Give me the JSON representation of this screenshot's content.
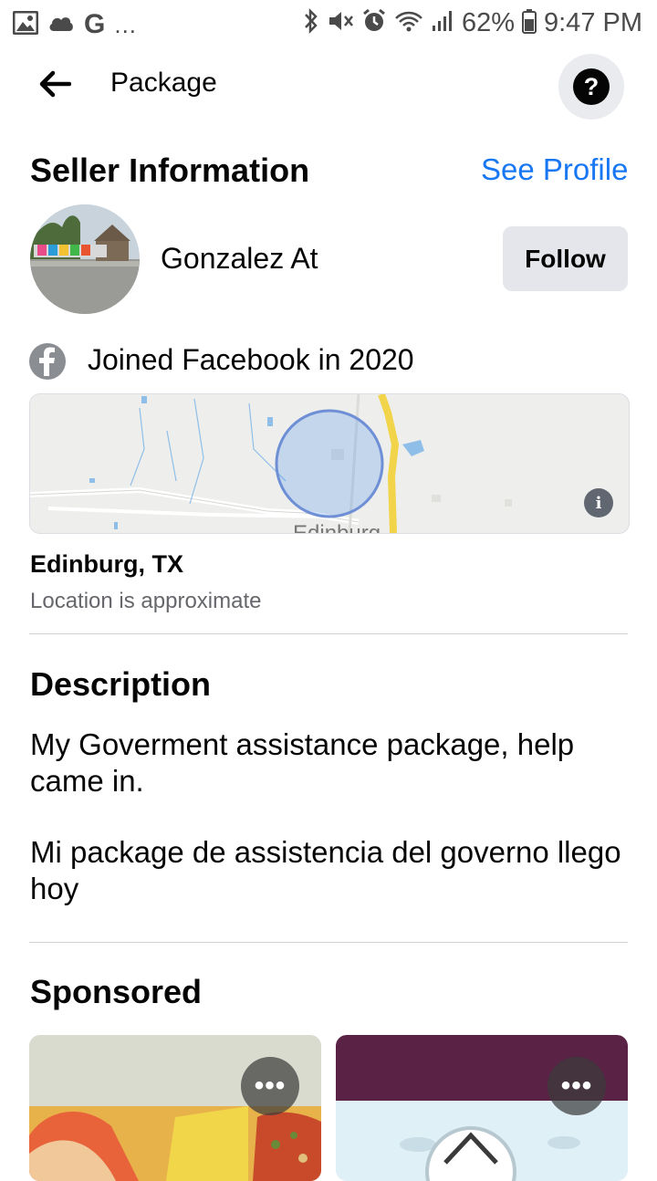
{
  "status_bar": {
    "left_g": "G",
    "left_dots": "...",
    "battery": "62%",
    "time": "9:47 PM"
  },
  "header": {
    "title": "Package",
    "help_symbol": "?"
  },
  "seller": {
    "section_title": "Seller Information",
    "see_profile": "See Profile",
    "name": "Gonzalez At",
    "follow_label": "Follow",
    "joined": "Joined Facebook in 2020",
    "location": "Edinburg, TX",
    "location_note": "Location is approximate"
  },
  "description": {
    "title": "Description",
    "paragraph_1": "My Goverment assistance package, help came in.",
    "paragraph_2": "Mi package de assistencia del governo llego hoy"
  },
  "sponsored": {
    "title": "Sponsored",
    "more_label": "•••"
  },
  "colors": {
    "accent": "#1877f2",
    "button_bg": "#e4e6eb",
    "secondary_text": "#65676b"
  }
}
